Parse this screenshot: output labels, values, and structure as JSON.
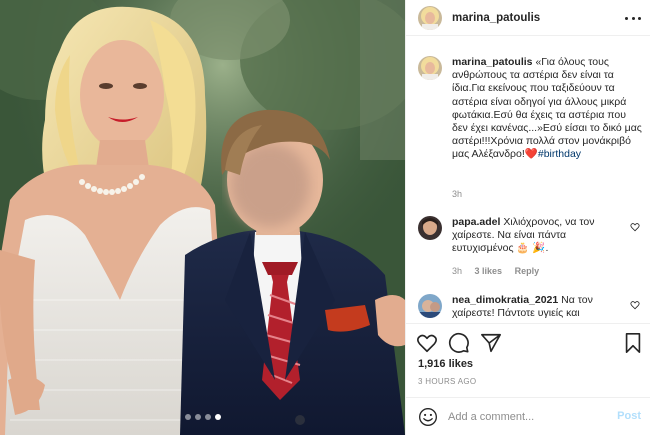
{
  "colors": {
    "text": "#262626",
    "muted": "#8e8e8e",
    "link": "#00376b",
    "post_disabled": "#b2dffc",
    "border": "#dbdbdb"
  },
  "post": {
    "photo_alt": "Photo",
    "carousel_active_index": 3,
    "carousel_count": 4
  },
  "header": {
    "username": "marina_patoulis",
    "more_icon": "more-horizontal-icon"
  },
  "caption": {
    "username": "marina_patoulis",
    "text": "«Για όλους τους ανθρώπους τα αστέρια δεν είναι τα ίδια.Για εκείνους που ταξιδεύουν τα αστέρια είναι οδηγοί για άλλους μικρά φωτάκια.Εσύ θα έχεις τα αστέρια που δεν έχει κανένας...»Εσύ είσαι το δικό μας αστέρι!!!Χρόνια πολλά στον μονάκριβό μας Αλέξανδρο!",
    "heart": "❤️",
    "hashtag": "#birthday",
    "time": "3h"
  },
  "comments": [
    {
      "username": "papa.adel",
      "text": "Χιλιόχρονος, να τον χαίρεστε. Να είναι πάντα ευτυχισμένος 🎂 🎉.",
      "time": "3h",
      "likes": "3 likes",
      "reply": "Reply"
    },
    {
      "username": "nea_dimokratia_2021",
      "text": "Να τον χαίρεστε! Πάντοτε υγιείς και"
    }
  ],
  "actions": {
    "like_icon": "heart-icon",
    "comment_icon": "comment-icon",
    "share_icon": "paper-plane-icon",
    "save_icon": "bookmark-icon"
  },
  "likes": "1,916 likes",
  "time_ago": "3 HOURS AGO",
  "add_comment": {
    "placeholder": "Add a comment...",
    "post_label": "Post"
  }
}
